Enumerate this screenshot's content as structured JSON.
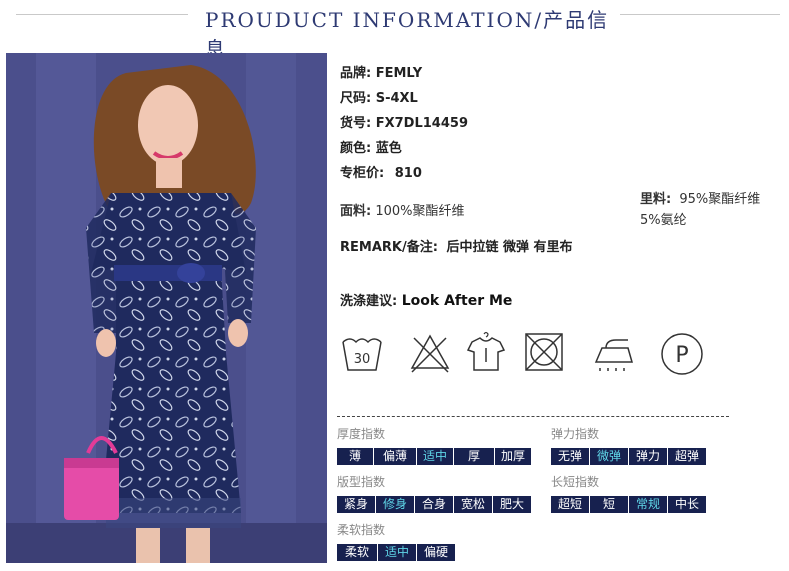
{
  "header": {
    "title": "PROUDUCT INFORMATION/产品信息"
  },
  "specs": [
    {
      "label": "品牌:",
      "value": "FEMLY"
    },
    {
      "label": "尺码:",
      "value": "S-4XL"
    },
    {
      "label": "货号:",
      "value": "FX7DL14459"
    },
    {
      "label": "颜色:",
      "value": "蓝色"
    },
    {
      "label": "专柜价:",
      "value": "810"
    }
  ],
  "fabric": {
    "label": "面料:",
    "value": "100%聚酯纤维"
  },
  "lining": {
    "label": "里料:",
    "value_line1": "95%聚酯纤维",
    "value_line2": "5%氨纶"
  },
  "remark": {
    "label": "REMARK/备注:",
    "value": "后中拉链 微弹 有里布"
  },
  "wash": {
    "label": "洗涤建议:",
    "value": "Look After Me"
  },
  "care_icons": [
    {
      "name": "wash-30-icon",
      "text": "30"
    },
    {
      "name": "no-bleach-icon"
    },
    {
      "name": "hang-dry-icon"
    },
    {
      "name": "no-tumble-dry-icon"
    },
    {
      "name": "iron-icon"
    },
    {
      "name": "dry-clean-p-icon",
      "text": "P"
    }
  ],
  "indices": {
    "thickness": {
      "label": "厚度指数",
      "options": [
        "薄",
        "偏薄",
        "适中",
        "厚",
        "加厚"
      ],
      "selected": "适中"
    },
    "elasticity": {
      "label": "弹力指数",
      "options": [
        "无弹",
        "微弹",
        "弹力",
        "超弹"
      ],
      "selected": "微弹"
    },
    "fit": {
      "label": "版型指数",
      "options": [
        "紧身",
        "修身",
        "合身",
        "宽松",
        "肥大"
      ],
      "selected": "修身"
    },
    "length": {
      "label": "长短指数",
      "options": [
        "超短",
        "短",
        "常规",
        "中长"
      ],
      "selected": "常规"
    },
    "softness": {
      "label": "柔软指数",
      "options": [
        "柔软",
        "适中",
        "偏硬"
      ],
      "selected": "适中"
    }
  },
  "colors": {
    "title": "#2e3a73",
    "tag_bg": "#17214f",
    "tag_selected_text": "#5fd6e8"
  }
}
